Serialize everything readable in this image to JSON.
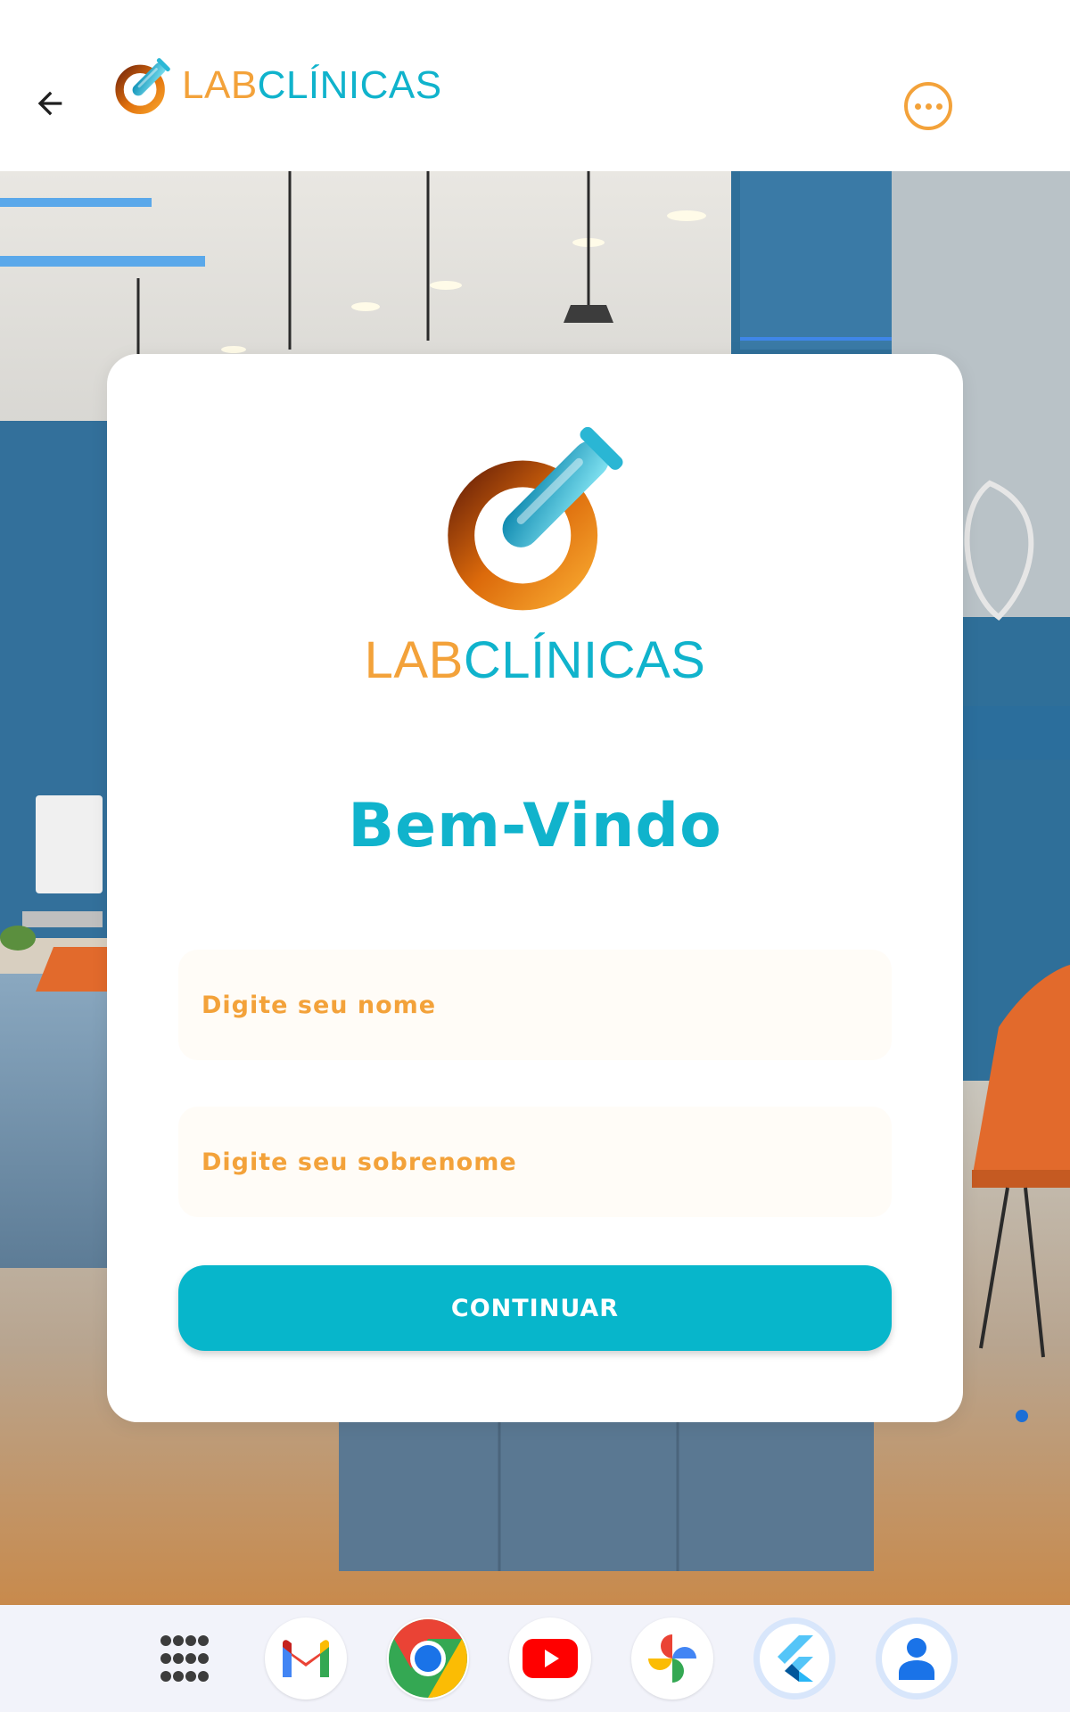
{
  "app_bar": {
    "back_icon": "arrow-left-icon",
    "brand_part1": "LAB",
    "brand_part2": "CLÍNICAS",
    "more_icon": "more-horizontal-circle-icon"
  },
  "card": {
    "brand_part1": "LAB",
    "brand_part2": "CLÍNICAS",
    "welcome_title": "Bem-Vindo",
    "name_field": {
      "placeholder": "Digite seu nome",
      "value": ""
    },
    "surname_field": {
      "placeholder": "Digite seu sobrenome",
      "value": ""
    },
    "continue_label": "CONTINUAR"
  },
  "taskbar": {
    "apps": [
      {
        "name": "all-apps-icon"
      },
      {
        "name": "gmail-icon"
      },
      {
        "name": "chrome-icon"
      },
      {
        "name": "youtube-icon"
      },
      {
        "name": "photos-icon"
      },
      {
        "name": "flutter-icon"
      },
      {
        "name": "contacts-icon"
      }
    ]
  },
  "colors": {
    "brand_orange": "#f3a23a",
    "brand_cyan": "#10b3cc",
    "button_cyan": "#07b6cb"
  }
}
